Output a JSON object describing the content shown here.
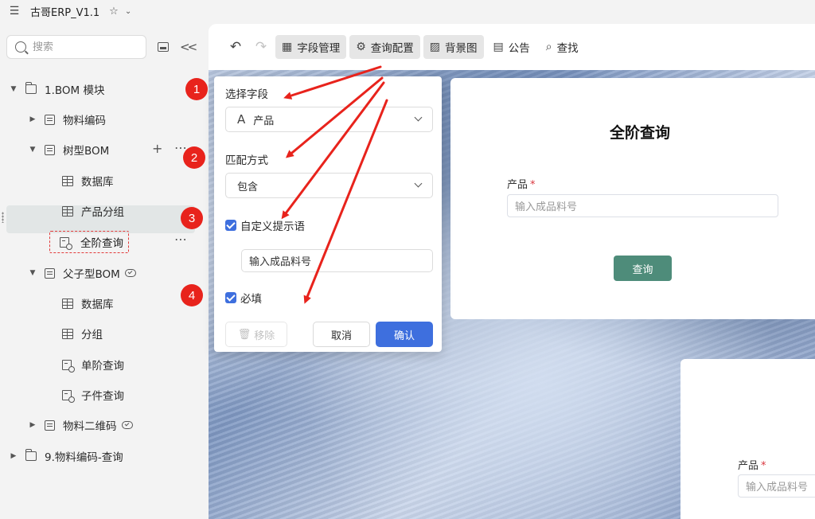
{
  "window": {
    "title": "古哥ERP_V1.1"
  },
  "sidebar": {
    "search_placeholder": "搜索",
    "tree": [
      {
        "label": "1.BOM 模块"
      },
      {
        "label": "物料编码"
      },
      {
        "label": "树型BOM"
      },
      {
        "label": "数据库"
      },
      {
        "label": "产品分组"
      },
      {
        "label": "全阶查询"
      },
      {
        "label": "父子型BOM"
      },
      {
        "label": "数据库"
      },
      {
        "label": "分组"
      },
      {
        "label": "单阶查询"
      },
      {
        "label": "子件查询"
      },
      {
        "label": "物料二维码"
      },
      {
        "label": "9.物料编码-查询"
      }
    ]
  },
  "toolbar": {
    "field_manage": "字段管理",
    "query_config": "查询配置",
    "background": "背景图",
    "notice": "公告",
    "find": "查找"
  },
  "popup": {
    "select_field_label": "选择字段",
    "select_field_value": "产品",
    "match_label": "匹配方式",
    "match_value": "包含",
    "custom_hint_label": "自定义提示语",
    "custom_hint_checked": true,
    "custom_hint_value": "输入成品料号",
    "required_label": "必填",
    "required_checked": true,
    "remove_label": "移除",
    "cancel_label": "取消",
    "ok_label": "确认"
  },
  "form": {
    "title": "全阶查询",
    "field_label": "产品",
    "required_mark": "*",
    "field_placeholder": "输入成品料号",
    "query_button": "查询"
  },
  "form2": {
    "field_label": "产品",
    "required_mark": "*",
    "field_placeholder": "输入成品料号"
  },
  "badges": [
    "1",
    "2",
    "3",
    "4"
  ],
  "colors": {
    "accent_blue": "#3e6fde",
    "query_green": "#4e8c7a",
    "badge_red": "#e8231c",
    "highlight_red": "#e23b3b"
  }
}
